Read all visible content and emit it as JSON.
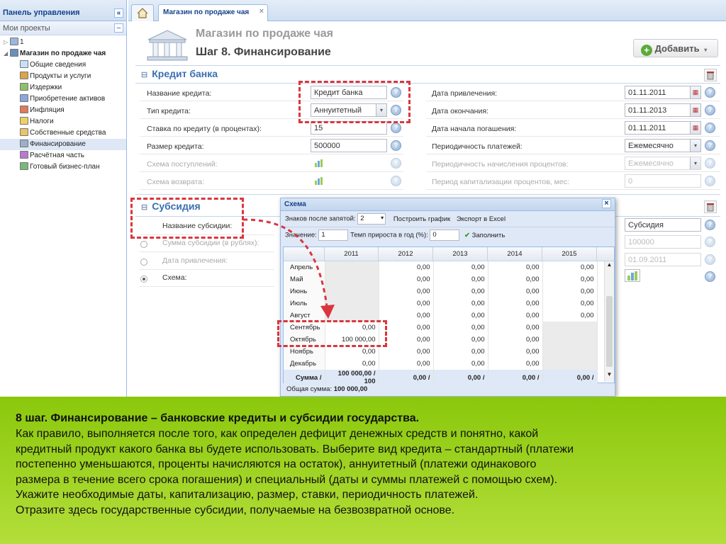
{
  "left_panel": {
    "title": "Панель управления",
    "collapse": "«",
    "projects_label": "Мои проекты",
    "projects_btn": "–",
    "tree": [
      {
        "label": "1",
        "level": 0
      },
      {
        "label": "Магазин по продаже чая",
        "level": 0,
        "bold": true
      },
      {
        "label": "Общие сведения",
        "level": 1
      },
      {
        "label": "Продукты и услуги",
        "level": 1
      },
      {
        "label": "Издержки",
        "level": 1
      },
      {
        "label": "Приобретение активов",
        "level": 1
      },
      {
        "label": "Инфляция",
        "level": 1
      },
      {
        "label": "Налоги",
        "level": 1
      },
      {
        "label": "Собственные средства",
        "level": 1
      },
      {
        "label": "Финансирование",
        "level": 1,
        "selected": true
      },
      {
        "label": "Расчётная часть",
        "level": 1
      },
      {
        "label": "Готовый бизнес-план",
        "level": 1
      }
    ]
  },
  "tabs": {
    "active": "Магазин по продаже чая",
    "close": "×"
  },
  "header": {
    "project": "Магазин по продаже чая",
    "step": "Шаг 8. Финансирование",
    "add_button": "Добавить"
  },
  "credit": {
    "title": "Кредит банка",
    "left_fields": [
      {
        "label": "Название кредита:",
        "value": "Кредит банка"
      },
      {
        "label": "Тип кредита:",
        "value": "Аннуитетный"
      },
      {
        "label": "Ставка по кредиту (в процентах):",
        "value": "15"
      },
      {
        "label": "Размер кредита:",
        "value": "500000"
      },
      {
        "label": "Схема поступлений:",
        "value": ""
      },
      {
        "label": "Схема возврата:",
        "value": ""
      }
    ],
    "right_fields": [
      {
        "label": "Дата привлечения:",
        "value": "01.11.2011"
      },
      {
        "label": "Дата окончания:",
        "value": "01.11.2013"
      },
      {
        "label": "Дата начала погашения:",
        "value": "01.11.2011"
      },
      {
        "label": "Периодичность платежей:",
        "value": "Ежемесячно"
      },
      {
        "label": "Периодичность начисления процентов:",
        "value": "Ежемесячно"
      },
      {
        "label": "Период капитализации процентов, мес:",
        "value": "0"
      }
    ]
  },
  "subsidy": {
    "title": "Субсидия",
    "fields": [
      {
        "label": "Название субсидии:"
      },
      {
        "label": "Сумма субсидии (в рублях):"
      },
      {
        "label": "Дата привлечения:"
      },
      {
        "label": "Схема:"
      }
    ],
    "right_values": [
      "Субсидия",
      "100000",
      "01.09.2011"
    ]
  },
  "dialog": {
    "title": "Схема",
    "close": "×",
    "decimals_label": "Знаков после запятой:",
    "decimals_value": "2",
    "build_chart": "Построить график",
    "export": "Экспорт в Excel",
    "value_label": "Значение:",
    "value_value": "1",
    "growth_label": "Темп прироста в год (%):",
    "growth_value": "0",
    "fill_button": "Заполнить",
    "years": [
      "2011",
      "2012",
      "2013",
      "2014",
      "2015"
    ],
    "rows": [
      {
        "month": "Апрель",
        "vals": [
          "",
          "0,00",
          "0,00",
          "0,00",
          "0,00"
        ]
      },
      {
        "month": "Май",
        "vals": [
          "",
          "0,00",
          "0,00",
          "0,00",
          "0,00"
        ]
      },
      {
        "month": "Июнь",
        "vals": [
          "",
          "0,00",
          "0,00",
          "0,00",
          "0,00"
        ]
      },
      {
        "month": "Июль",
        "vals": [
          "",
          "0,00",
          "0,00",
          "0,00",
          "0,00"
        ]
      },
      {
        "month": "Август",
        "vals": [
          "",
          "0,00",
          "0,00",
          "0,00",
          "0,00"
        ]
      },
      {
        "month": "Сентябрь",
        "vals": [
          "0,00",
          "0,00",
          "0,00",
          "0,00",
          ""
        ]
      },
      {
        "month": "Октябрь",
        "vals": [
          "100 000,00",
          "0,00",
          "0,00",
          "0,00",
          ""
        ]
      },
      {
        "month": "Ноябрь",
        "vals": [
          "0,00",
          "0,00",
          "0,00",
          "0,00",
          ""
        ]
      },
      {
        "month": "Декабрь",
        "vals": [
          "0,00",
          "0,00",
          "0,00",
          "0,00",
          ""
        ]
      }
    ],
    "sum_label": "Сумма /",
    "sums": [
      "100 000,00 / 100",
      "0,00 /",
      "0,00 /",
      "0,00 /",
      "0,00 /"
    ],
    "total_label": "Общая сумма:",
    "total_value": "100 000,00"
  },
  "note": {
    "title": "8 шаг. Финансирование – банковские кредиты и субсидии государства.",
    "lines": [
      "Как правило,  выполняется после того, как определен дефицит денежных средств и понятно, какой",
      "кредитный продукт какого банка вы будете использовать. Выберите вид кредита – стандартный (платежи",
      "постепенно уменьшаются, проценты начисляются на остаток), аннуитетный  (платежи одинакового",
      "размера в течение всего срока погашения) и специальный (даты и суммы платежей с помощью схем).",
      "Укажите необходимые даты, капитализацию,  размер, ставки, периодичность платежей.",
      "Отразите здесь государственные субсидии, получаемые на безвозвратной основе."
    ]
  },
  "colors": {
    "accent": "#3a6fb0",
    "highlight": "#d9363e",
    "overlay": "#9acd1e"
  }
}
